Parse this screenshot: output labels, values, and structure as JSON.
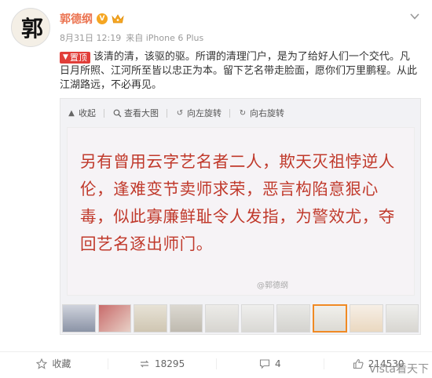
{
  "post": {
    "author": "郭德纲",
    "avatar_glyph": "郭",
    "date": "8月31日 12:19",
    "source_prefix": "来自",
    "source": "iPhone 6 Plus",
    "pin_label": "置顶",
    "text": "该清的清，该驱的驱。所谓的清理门户，是为了给好人们一个交代。凡日月所照、江河所至皆以忠正为本。留下艺名带走脸面，愿你们万里鹏程。从此江湖路远，不必再见。"
  },
  "media": {
    "toolbar": {
      "collapse": "收起",
      "view_large": "查看大图",
      "rotate_left": "向左旋转",
      "rotate_right": "向右旋转"
    },
    "quote": "另有曾用云字艺名者二人，欺天灭祖悖逆人伦，逢难变节卖师求荣，恶言构陷意狠心毒，似此寡廉鲜耻令人发指，为警效尤，夺回艺名逐出师门。",
    "watermark": "@郭德纲",
    "thumb_count": 10,
    "active_thumb": 8
  },
  "actions": {
    "favorite": "收藏",
    "repost_count": "18295",
    "comment_count": "4",
    "like_count": "214530"
  },
  "brand_watermark": "Vista看天下",
  "colors": {
    "author": "#eb7350",
    "pin": "#e13e39",
    "quote": "#c0392b",
    "active_thumb": "#f08a24"
  }
}
